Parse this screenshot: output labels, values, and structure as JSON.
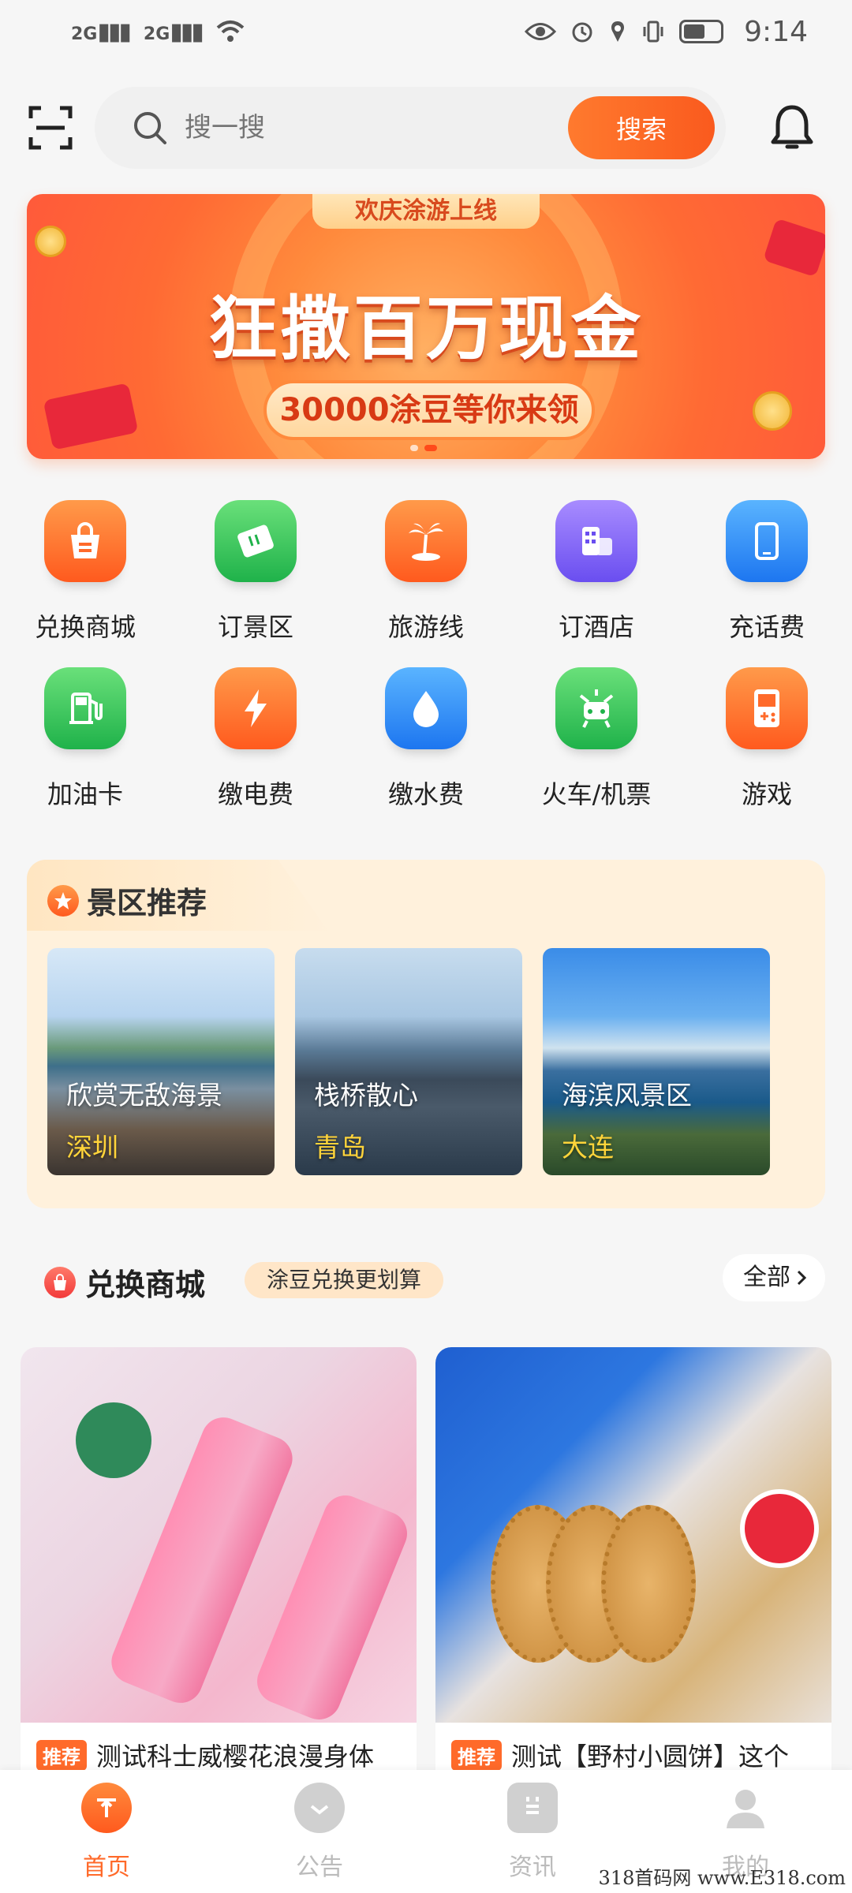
{
  "status_bar": {
    "signal_1": "2G",
    "signal_2": "2G",
    "time": "9:14"
  },
  "header": {
    "search_placeholder": "搜一搜",
    "search_button": "搜索"
  },
  "banner": {
    "tag": "欢庆涂游上线",
    "title": "狂撒百万现金",
    "subtitle": "30000涂豆等你来领"
  },
  "grid": {
    "items": [
      {
        "label": "兑换商城",
        "icon": "shopping-bag-icon"
      },
      {
        "label": "订景区",
        "icon": "ticket-icon"
      },
      {
        "label": "旅游线",
        "icon": "palm-tree-icon"
      },
      {
        "label": "订酒店",
        "icon": "hotel-icon"
      },
      {
        "label": "充话费",
        "icon": "phone-icon"
      },
      {
        "label": "加油卡",
        "icon": "fuel-icon"
      },
      {
        "label": "缴电费",
        "icon": "lightning-icon"
      },
      {
        "label": "缴水费",
        "icon": "water-drop-icon"
      },
      {
        "label": "火车/机票",
        "icon": "train-icon"
      },
      {
        "label": "游戏",
        "icon": "game-icon"
      }
    ]
  },
  "scenic": {
    "title": "景区推荐",
    "cards": [
      {
        "name": "欣赏无敌海景",
        "city": "深圳"
      },
      {
        "name": "栈桥散心",
        "city": "青岛"
      },
      {
        "name": "海滨风景区",
        "city": "大连"
      }
    ]
  },
  "exchange": {
    "title": "兑换商城",
    "pill": "涂豆兑换更划算",
    "all_label": "全部",
    "products": [
      {
        "tag": "推荐",
        "title": "测试科士威樱花浪漫身体"
      },
      {
        "tag": "推荐",
        "title": "测试【野村小圆饼】这个"
      }
    ]
  },
  "bottom_nav": {
    "items": [
      {
        "label": "首页",
        "active": true
      },
      {
        "label": "公告",
        "active": false
      },
      {
        "label": "资讯",
        "active": false
      },
      {
        "label": "我的",
        "active": false
      }
    ]
  },
  "watermark": "318首码网 www.E318.com",
  "colors": {
    "accent": "#ff6a2a",
    "nav_inactive": "#bbbbbb",
    "city_label": "#ffd43a"
  }
}
